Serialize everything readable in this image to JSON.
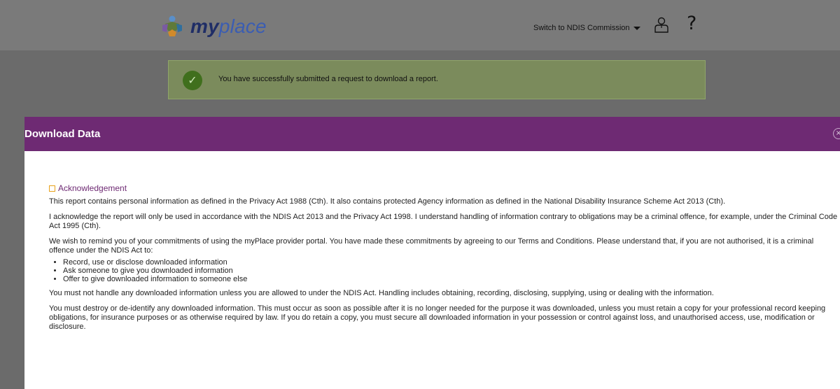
{
  "header": {
    "logo_text_my": "my",
    "logo_text_place": "place",
    "switch_link": "Switch to NDIS Commission",
    "icons": [
      "logo-mark-icon",
      "user-icon",
      "help-icon"
    ],
    "help_glyph": "?"
  },
  "alert": {
    "message": "You have successfully submitted a request to download a report.",
    "icon": "check-circle-icon",
    "check_glyph": "✓"
  },
  "modal": {
    "title": "Download Data",
    "close_glyph": "×",
    "acknowledgement_heading": "Acknowledgement",
    "paragraphs": [
      "This report contains personal information as defined in the Privacy Act 1988 (Cth). It also contains protected Agency information as defined in the National Disability Insurance Scheme Act 2013 (Cth).",
      "I acknowledge the report will only be used in accordance with the NDIS Act 2013 and the Privacy Act 1998. I understand handling of information contrary to obligations may be a criminal offence, for example, under the Criminal Code Act 1995 (Cth).",
      "We wish to remind you of your commitments of using the myPlace provider portal. You have made these commitments by agreeing to our Terms and Conditions. Please understand that, if you are not authorised, it is a criminal offence under the NDIS Act to:"
    ],
    "bullets": [
      "Record, use or disclose downloaded information",
      "Ask someone to give you downloaded information",
      "Offer to give downloaded information to someone else"
    ],
    "paragraphs_after": [
      "You must not handle any downloaded information unless you are allowed to under the NDIS Act. Handling includes obtaining, recording, disclosing, supplying, using or dealing with the information.",
      "You must destroy or de-identify any downloaded information. This must occur as soon as possible after it is no longer needed for the purpose it was downloaded, unless you must retain a copy for your professional record keeping obligations, for insurance purposes or as otherwise required by law. If you do retain a copy, you must secure all downloaded information in your possession or control against loss, and unauthorised access, use, modification or disclosure."
    ]
  },
  "colors": {
    "modal_header": "#6e2a73",
    "acknowledgement_text": "#6e2a73",
    "checkbox_border": "#e8a11a",
    "alert_icon": "#406f1d",
    "overlay": "#6b6b6b"
  }
}
